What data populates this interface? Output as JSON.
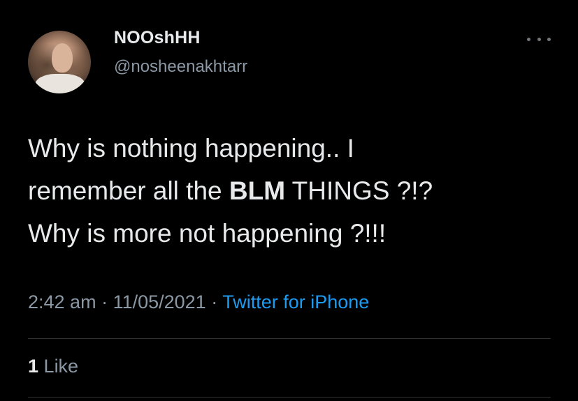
{
  "tweet": {
    "author_name": "NOOshHH",
    "author_handle": "@nosheenakhtarr",
    "text_lines": [
      {
        "pre": "Why is nothing happening.. I",
        "bold": "",
        "post": ""
      },
      {
        "pre": "remember all the ",
        "bold": "BLM",
        "post": " THINGS ?!?"
      },
      {
        "pre": "Why is more not happening ?!!!",
        "bold": "",
        "post": ""
      }
    ],
    "time": "2:42 am",
    "separator": " · ",
    "date": "11/05/2021",
    "source": "Twitter for iPhone",
    "like_count": "1",
    "like_label": "Like"
  },
  "icons": {
    "more": "more-horizontal-icon",
    "avatar": "avatar"
  },
  "colors": {
    "background": "#000000",
    "primary_text": "#e7e9ea",
    "secondary_text": "#8b98a5",
    "link": "#1d9bf0",
    "divider": "#2f3336"
  }
}
